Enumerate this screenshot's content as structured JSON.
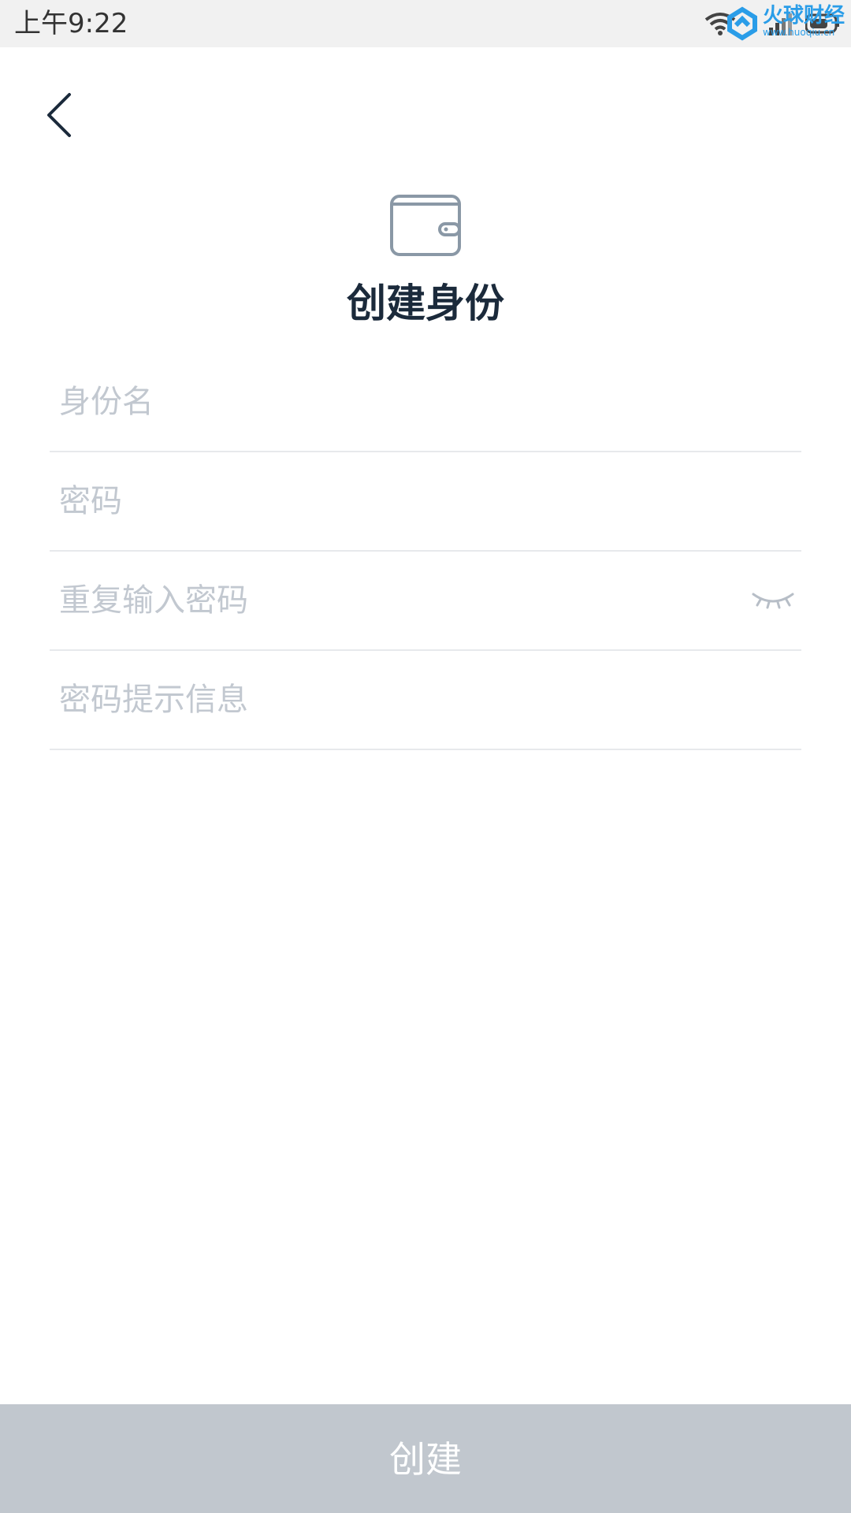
{
  "status_bar": {
    "time": "上午9:22",
    "icons": [
      "wifi-icon",
      "signal-icon",
      "battery-icon"
    ],
    "watermark_text": "火球财经",
    "watermark_url": "www.huoqiu.cn"
  },
  "nav": {
    "back_icon": "chevron-left-icon"
  },
  "header": {
    "icon": "wallet-icon",
    "title": "创建身份"
  },
  "form": {
    "identity_name_placeholder": "身份名",
    "password_placeholder": "密码",
    "repeat_password_placeholder": "重复输入密码",
    "password_hint_placeholder": "密码提示信息",
    "visibility_icon": "eye-closed-icon"
  },
  "footer": {
    "create_label": "创建",
    "button_color": "#c1c7ce"
  },
  "colors": {
    "title": "#1b2a3b",
    "placeholder": "#c2c8d0",
    "divider": "#e7e9ec",
    "status_bar_bg": "#f1f1f1"
  }
}
